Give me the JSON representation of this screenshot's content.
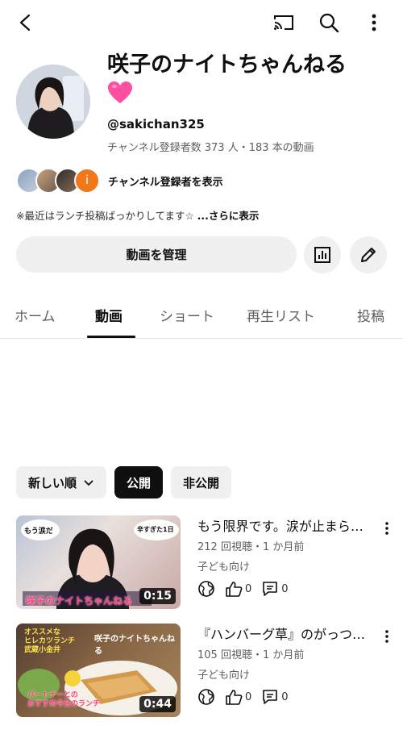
{
  "header": {
    "back_icon": "arrow-left-icon",
    "cast_icon": "cast-icon",
    "search_icon": "search-icon",
    "more_icon": "more-vert-icon"
  },
  "channel": {
    "title": "咲子のナイトちゃんねる",
    "title_emoji": "pink-heart",
    "handle": "@sakichan325",
    "meta": "チャンネル登録者数 373 人・183 本の動画",
    "subscribers_label": "チャンネル登録者を表示",
    "subscriber_avatar_letter": "i",
    "description": "※最近はランチ投稿ばっかりしてます☆",
    "description_more": "...さらに表示"
  },
  "actions": {
    "manage_label": "動画を管理",
    "stats_icon": "analytics-icon",
    "edit_icon": "pencil-icon"
  },
  "tabs": [
    {
      "label": "ホーム",
      "active": false
    },
    {
      "label": "動画",
      "active": true
    },
    {
      "label": "ショート",
      "active": false
    },
    {
      "label": "再生リスト",
      "active": false
    },
    {
      "label": "投稿",
      "active": false
    }
  ],
  "filters": {
    "sort_label": "新しい順",
    "public_label": "公開",
    "private_label": "非公開"
  },
  "videos": [
    {
      "title": "もう限界です。涙が止まらない",
      "meta": "212 回視聴・1 か月前",
      "audience": "子ども向け",
      "duration": "0:15",
      "likes": "0",
      "comments": "0",
      "thumb_caption": "咲子のナイトちゃんねる",
      "thumb_bubble_left": "もう涙だ",
      "thumb_bubble_right": "辛すぎた1日"
    },
    {
      "title": "『ハンバーグ草』のがっつりランチ",
      "meta": "105 回視聴・1 か月前",
      "audience": "子ども向け",
      "duration": "0:44",
      "likes": "0",
      "comments": "0",
      "thumb_top_left": "オススメな\nヒレカツランチ\n武蔵小金井",
      "thumb_top_right": "咲子のナイトちゃんねる",
      "thumb_bottom": "パートナーとの\nおすすめ今日のランチ"
    }
  ],
  "colors": {
    "accent_dark": "#0f0f0f",
    "chip_bg": "#f0f0f0",
    "secondary_text": "#606060",
    "heart": "#ff4fa3",
    "subscriber_orange": "#f0771a"
  }
}
